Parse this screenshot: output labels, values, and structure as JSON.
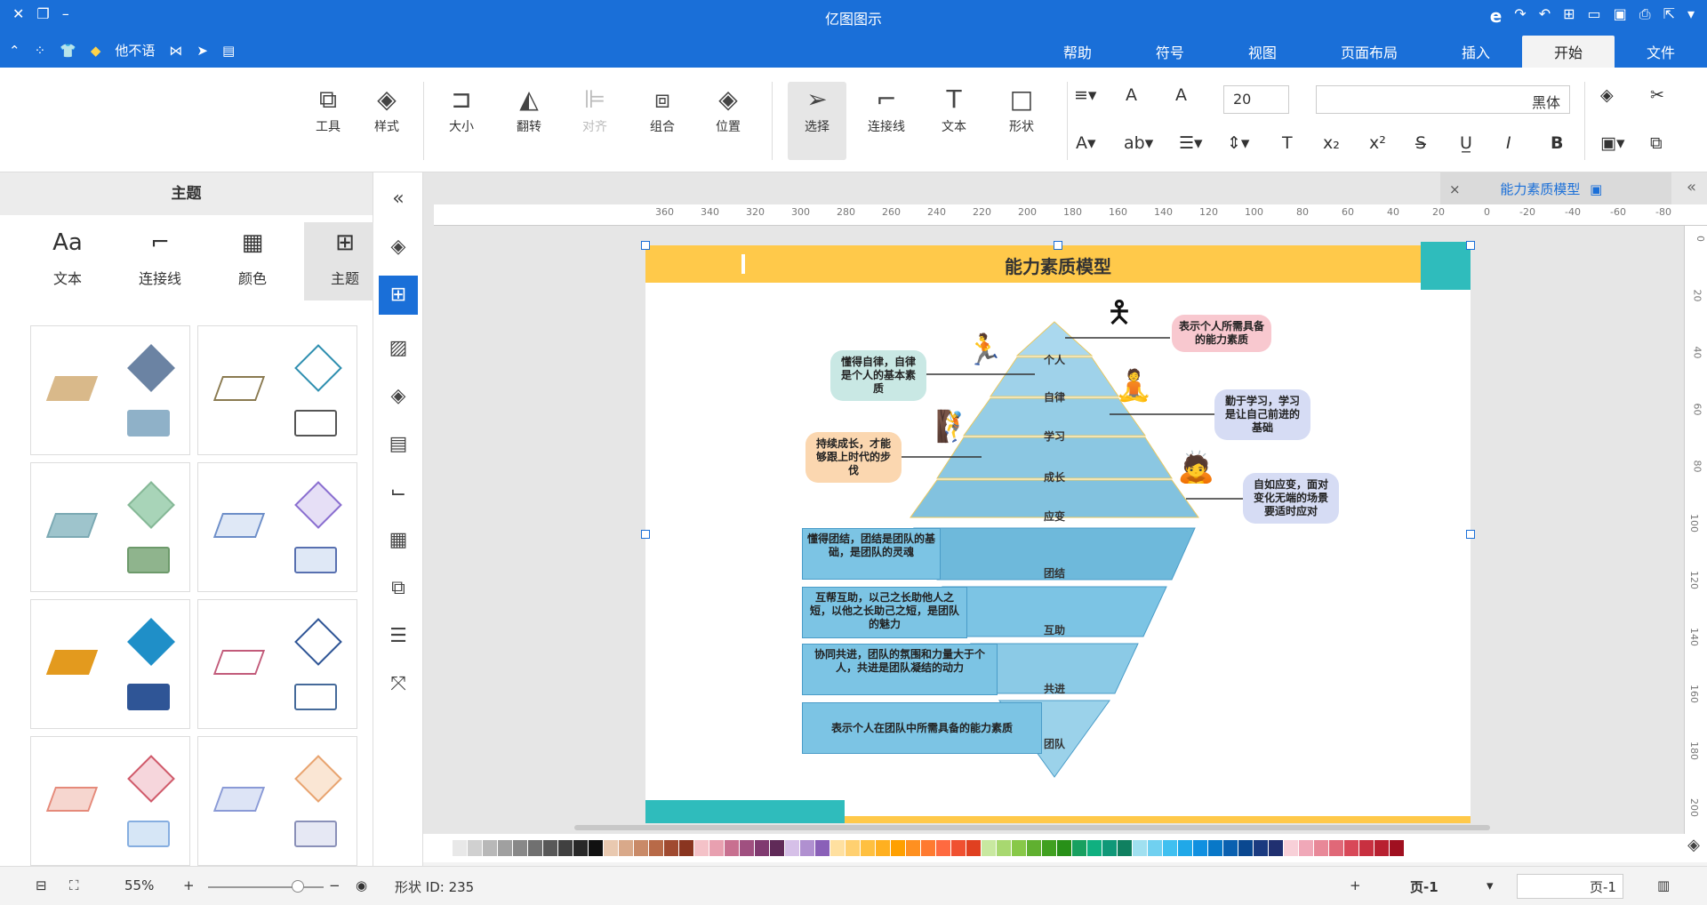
{
  "app": {
    "title": "亿图图示"
  },
  "menu": {
    "tabs": [
      "文件",
      "开始",
      "插入",
      "页面布局",
      "视图",
      "符号",
      "帮助"
    ],
    "active": "开始",
    "vip_label": "他不语"
  },
  "ribbon": {
    "font_name": "黑体",
    "font_size": "20",
    "buttons": {
      "shape": "形状",
      "text": "文本",
      "connector": "连接线",
      "select": "选择",
      "position": "位置",
      "group": "组合",
      "align": "对齐",
      "flip": "翻转",
      "size": "大小",
      "style": "样式",
      "tools": "工具"
    }
  },
  "left_panel": {
    "title": "主题",
    "tabs": [
      "主题",
      "颜色",
      "连接线",
      "文本"
    ],
    "tab_icons": [
      "theme-grid-icon",
      "color-grid-icon",
      "connector-icon",
      "text-aa-icon"
    ],
    "text_tab_glyph": "Aa"
  },
  "document": {
    "tab_title": "能力素质模型",
    "close": "×"
  },
  "diagram": {
    "title": "能力素质模型",
    "pyramid_levels": [
      "个人",
      "自律",
      "学习",
      "成长",
      "应变"
    ],
    "inverted_levels": [
      "团结",
      "互助",
      "共进",
      "团队"
    ],
    "bubbles": {
      "person": "表示个人所需具备的能力素质",
      "discipline": "懂得自律，自律是个人的基本素质",
      "study": "勤于学习，学习是让自己前进的基础",
      "growth": "持续成长，才能够跟上时代的步伐",
      "adapt": "自如应变，面对变化无端的场景要适时应对"
    },
    "boxes": {
      "unity": "懂得团结，团结是团队的基础，是团队的灵魂",
      "mutual": "互帮互助，以己之长助他人之短，以他之长助己之短，是团队的魅力",
      "progress": "协同共进，团队的氛围和力量大于个人，共进是团队凝结的动力",
      "team": "表示个人在团队中所需具备的能力素质"
    }
  },
  "ruler_h": [
    "-80",
    "-60",
    "-40",
    "-20",
    "0",
    "20",
    "40",
    "60",
    "80",
    "100",
    "120",
    "140",
    "160",
    "180",
    "200",
    "220",
    "240",
    "260",
    "280",
    "300",
    "320",
    "340",
    "360"
  ],
  "ruler_v": [
    "0",
    "20",
    "40",
    "60",
    "80",
    "100",
    "120",
    "140",
    "160",
    "180",
    "200"
  ],
  "status": {
    "page_left": "页-1",
    "page_right": "页-1",
    "add": "+",
    "shape_id": "形状 ID: 235",
    "zoom": "55%"
  },
  "colors": {
    "accent": "#1a6fd8",
    "header": "#ffc94a",
    "teal": "#2fbcbc",
    "pyramid": "#7cc4e4"
  }
}
